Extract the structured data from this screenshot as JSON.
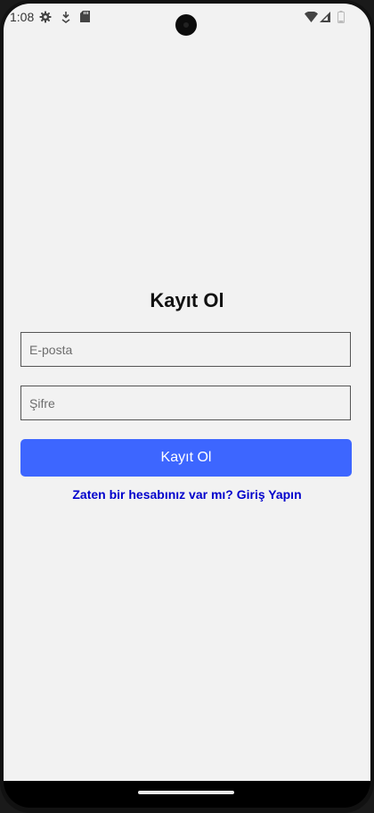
{
  "status_bar": {
    "time": "1:08",
    "left_icons": [
      "gear-icon",
      "download-icon",
      "sd-card-icon"
    ],
    "right_icons": [
      "wifi-icon",
      "signal-icon",
      "battery-icon"
    ]
  },
  "form": {
    "title": "Kayıt Ol",
    "email_placeholder": "E-posta",
    "password_placeholder": "Şifre",
    "submit_label": "Kayıt Ol",
    "login_link": "Zaten bir hesabınız var mı? Giriş Yapın"
  },
  "colors": {
    "background": "#f2f2f2",
    "button": "#3d66ff",
    "link": "#0000cc"
  }
}
